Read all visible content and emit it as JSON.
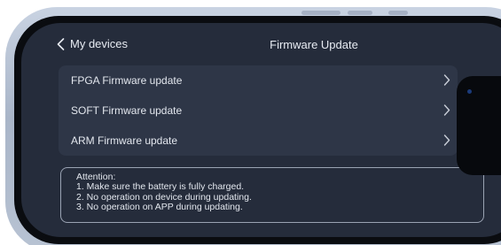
{
  "nav": {
    "back_label": "My devices",
    "title": "Firmware Update"
  },
  "list": {
    "items": [
      {
        "label": "FPGA Firmware update"
      },
      {
        "label": "SOFT Firmware update"
      },
      {
        "label": "ARM Firmware update"
      }
    ]
  },
  "attention": {
    "heading": "Attention:",
    "lines": [
      "1. Make sure the battery is fully charged.",
      "2. No operation on device during updating.",
      "3. No operation on APP during updating."
    ]
  },
  "icons": {
    "back": "chevron-left-icon",
    "row": "chevron-right-icon"
  },
  "colors": {
    "screen_bg": "#252c3b",
    "card_bg": "#2e3647",
    "text": "#e3e7ee",
    "frame": "#b8c3d3"
  }
}
